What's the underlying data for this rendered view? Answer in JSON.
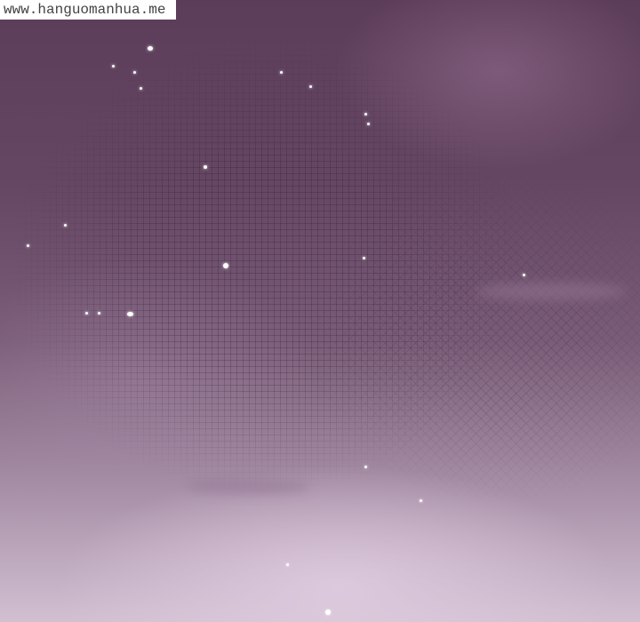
{
  "watermark": {
    "text": "www.hanguomanhua.me"
  },
  "scene": {
    "palette": {
      "top": "#5c3d59",
      "mid": "#7a5d78",
      "bottom": "#d2c0d2",
      "pole": "#8a5a36"
    }
  }
}
